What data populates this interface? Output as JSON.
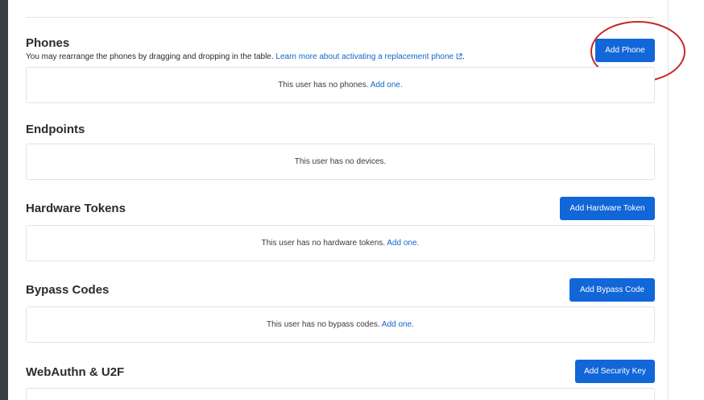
{
  "phones": {
    "title": "Phones",
    "description_text": "You may rearrange the phones by dragging and dropping in the table.",
    "learn_more_link": "Learn more about activating a replacement phone",
    "description_end": ".",
    "empty_message": "This user has no phones.",
    "add_link": "Add one.",
    "add_button": "Add Phone"
  },
  "endpoints": {
    "title": "Endpoints",
    "empty_message": "This user has no devices."
  },
  "hardware_tokens": {
    "title": "Hardware Tokens",
    "empty_message": "This user has no hardware tokens.",
    "add_link": "Add one.",
    "add_button": "Add Hardware Token"
  },
  "bypass_codes": {
    "title": "Bypass Codes",
    "empty_message": "This user has no bypass codes.",
    "add_link": "Add one.",
    "add_button": "Add Bypass Code"
  },
  "webauthn": {
    "title": "WebAuthn & U2F",
    "add_button": "Add Security Key"
  },
  "colors": {
    "primary_button": "#1166d8",
    "link": "#1166cc",
    "annotation": "#c62828",
    "left_rail": "#3a3f44"
  },
  "icons": {
    "external_link": "external-link-icon"
  }
}
